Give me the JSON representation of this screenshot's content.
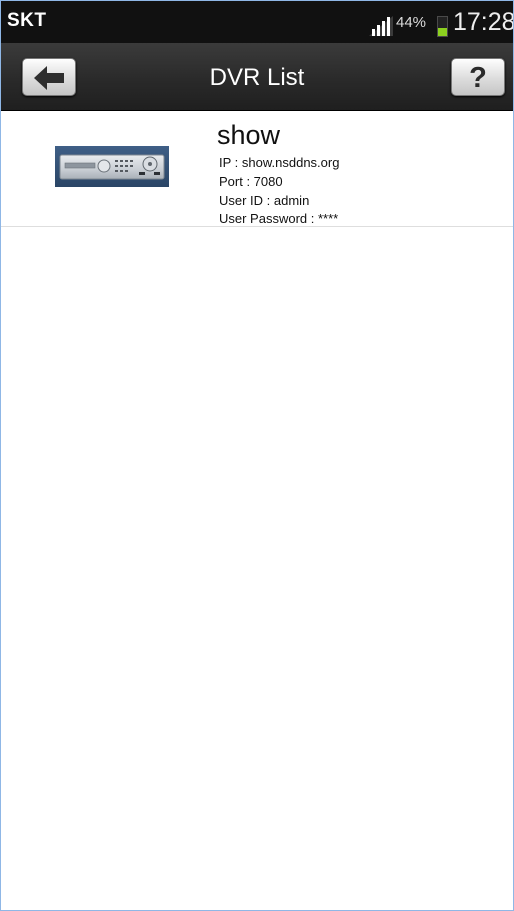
{
  "status_bar": {
    "carrier": "SKT",
    "battery_percent": "44%",
    "battery_level": 0.44,
    "time": "17:28",
    "signal_icon": "signal-bars-icon",
    "battery_icon": "battery-icon"
  },
  "header": {
    "title": "DVR List",
    "back_icon": "arrow-left-icon",
    "help_label": "?"
  },
  "dvr_list": {
    "items": [
      {
        "name": "show",
        "ip": "IP : show.nsddns.org",
        "port": "Port : 7080",
        "user_id": "User ID : admin",
        "user_password": "User Password : ****",
        "thumbnail_icon": "dvr-device-icon"
      }
    ]
  },
  "colors": {
    "status_bar_bg": "#111111",
    "title_bar_bg": "#2a2a2a",
    "battery_fill": "#8cd01f",
    "list_bg": "#ffffff"
  }
}
